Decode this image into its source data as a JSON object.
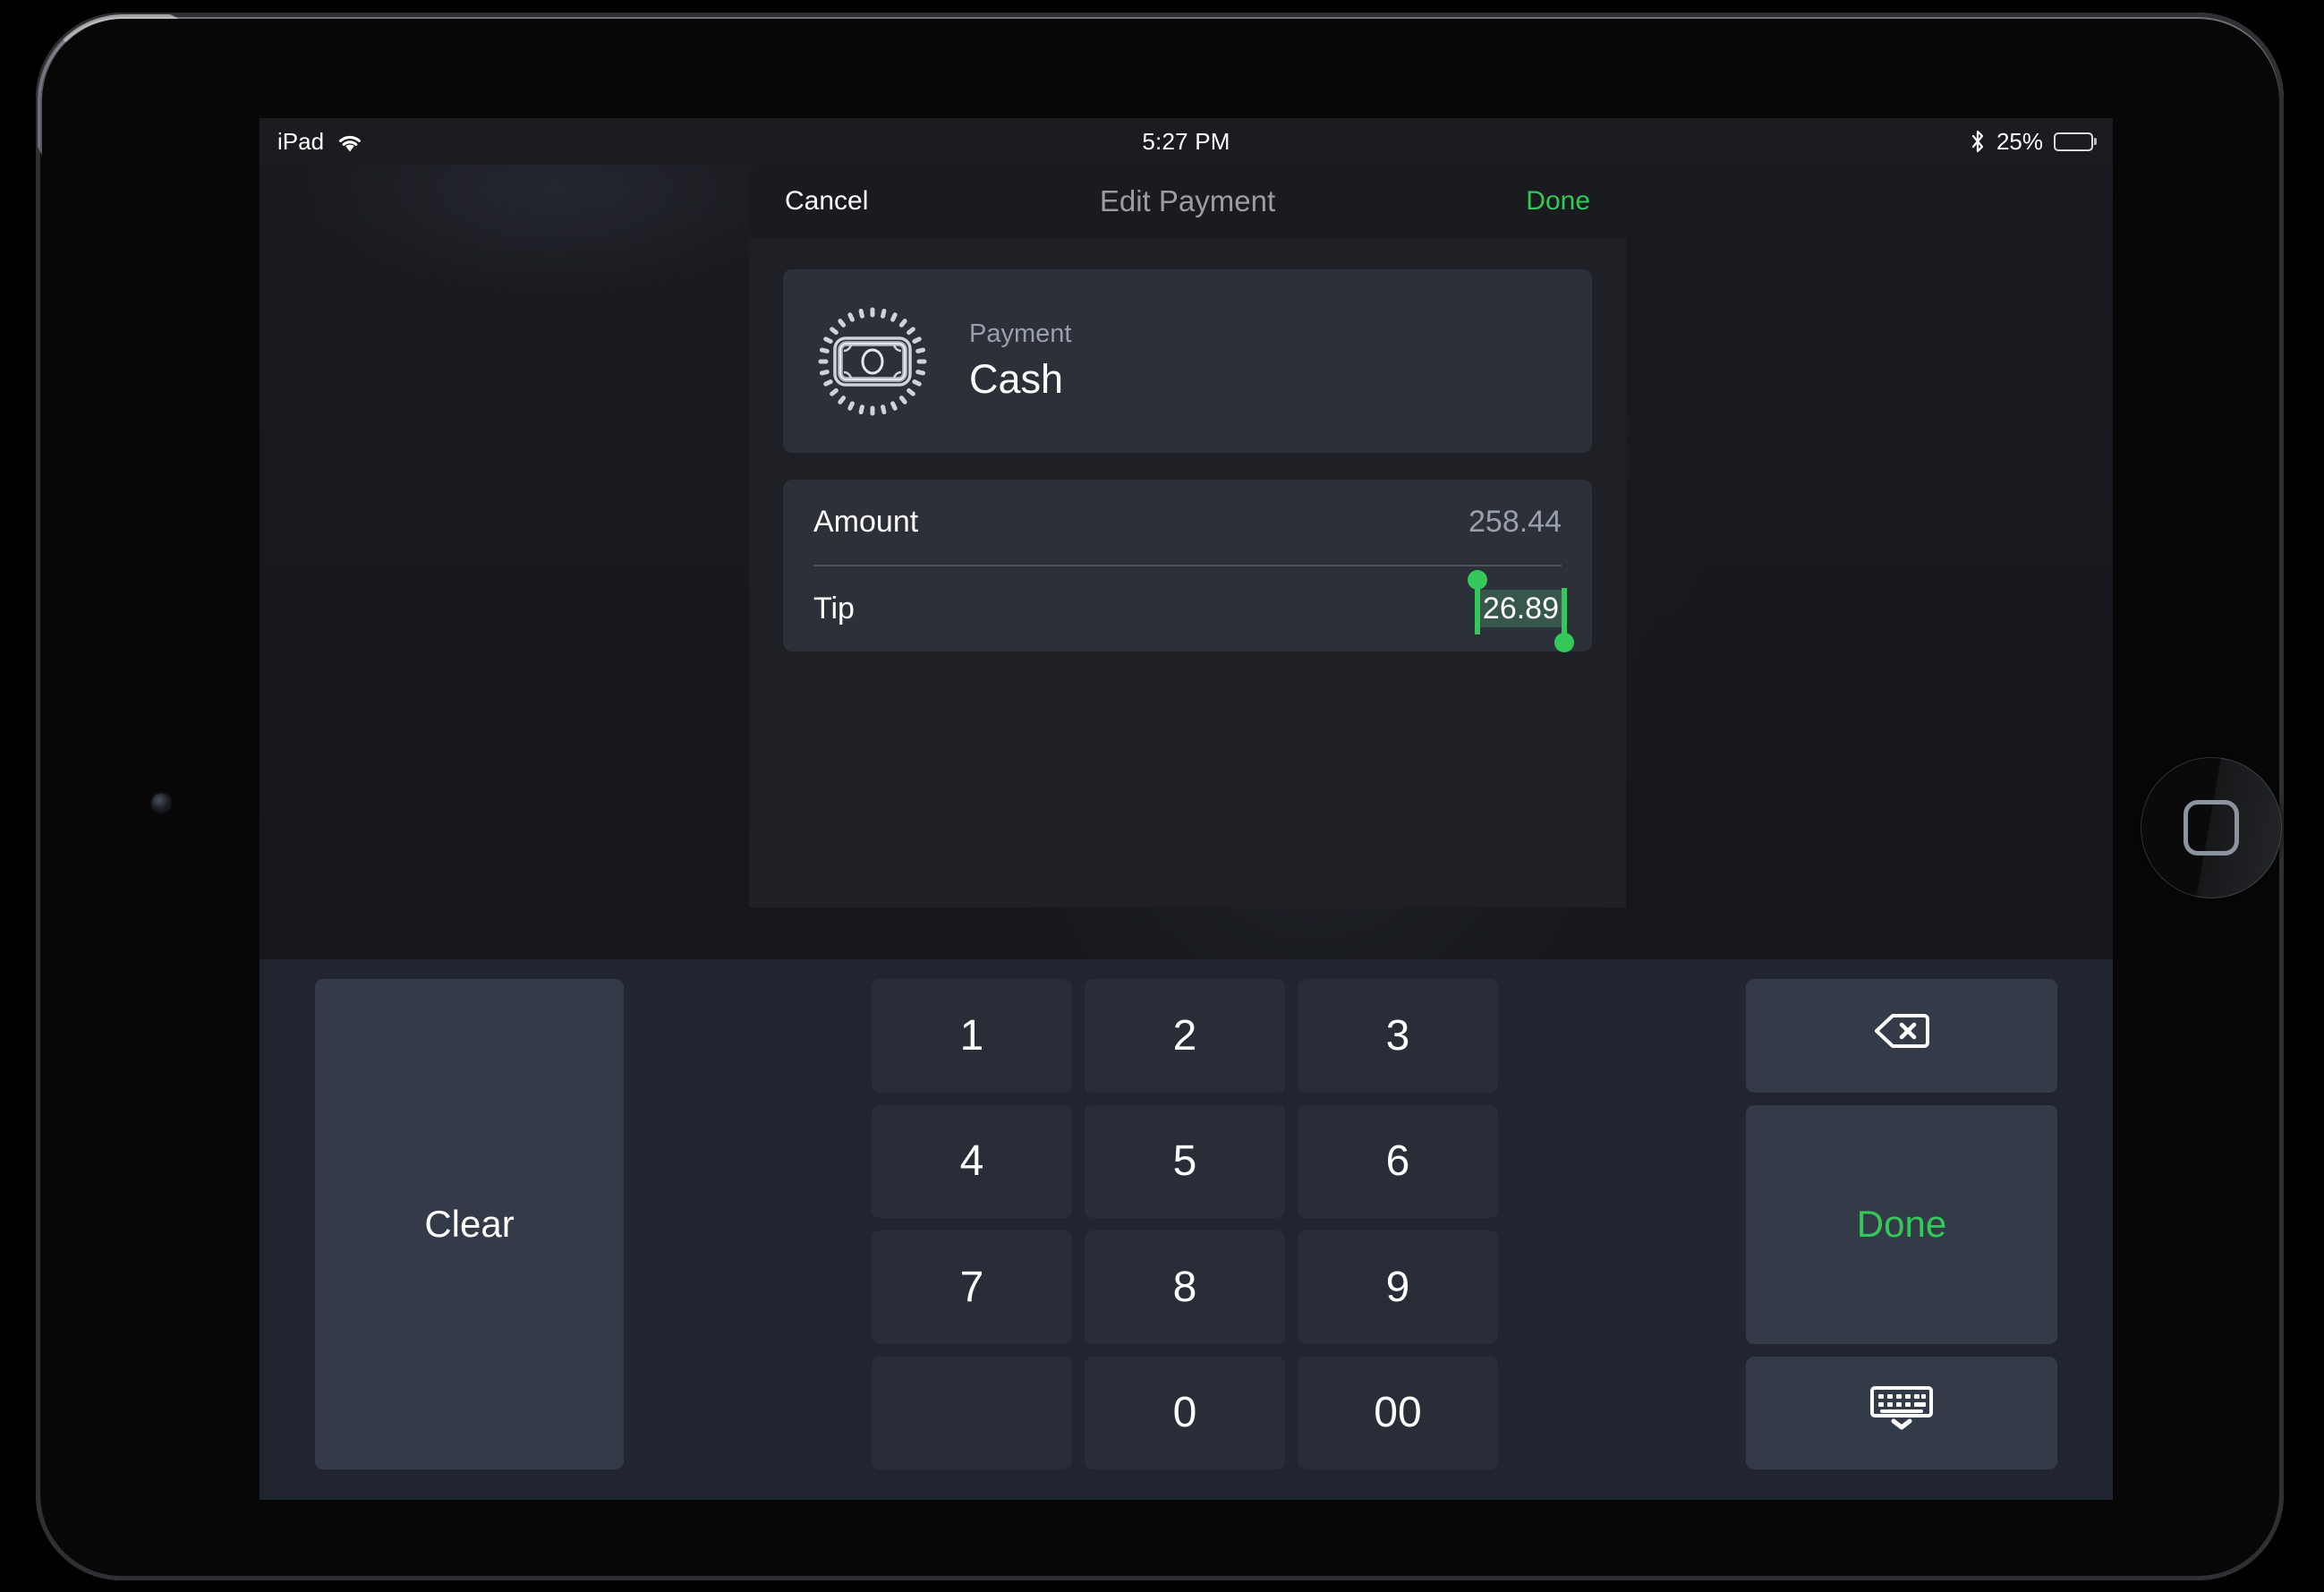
{
  "device": {
    "name": "ipad",
    "home_button_icon": "home-square-icon",
    "camera_icon": "front-camera"
  },
  "status_bar": {
    "carrier": "iPad",
    "wifi_icon": "wifi-icon",
    "time": "5:27 PM",
    "bluetooth_icon": "bluetooth-icon",
    "battery_percent": "25%",
    "battery_level": 25,
    "battery_icon": "battery-icon"
  },
  "modal": {
    "cancel_label": "Cancel",
    "title": "Edit Payment",
    "done_label": "Done",
    "payment_card": {
      "icon": "cash-banknote-icon",
      "label": "Payment",
      "value": "Cash"
    },
    "fields": [
      {
        "label": "Amount",
        "value": "258.44",
        "selected": false
      },
      {
        "label": "Tip",
        "value": "26.89",
        "selected": true
      }
    ]
  },
  "keypad": {
    "clear_label": "Clear",
    "keys": [
      "1",
      "2",
      "3",
      "4",
      "5",
      "6",
      "7",
      "8",
      "9",
      "",
      "0",
      "00"
    ],
    "backspace_icon": "backspace-delete-icon",
    "done_label": "Done",
    "hide_keyboard_icon": "hide-keyboard-icon"
  },
  "colors": {
    "accent_green": "#34c759",
    "selection_fill": "#37574a",
    "keypad_bg": "#212530",
    "key_bg": "#282d38",
    "key_large_bg": "#343b48",
    "card_bg": "#2b3039",
    "modal_bg": "#1e2026",
    "header_bg": "#191b1f",
    "muted_text": "#9aa0ab"
  }
}
